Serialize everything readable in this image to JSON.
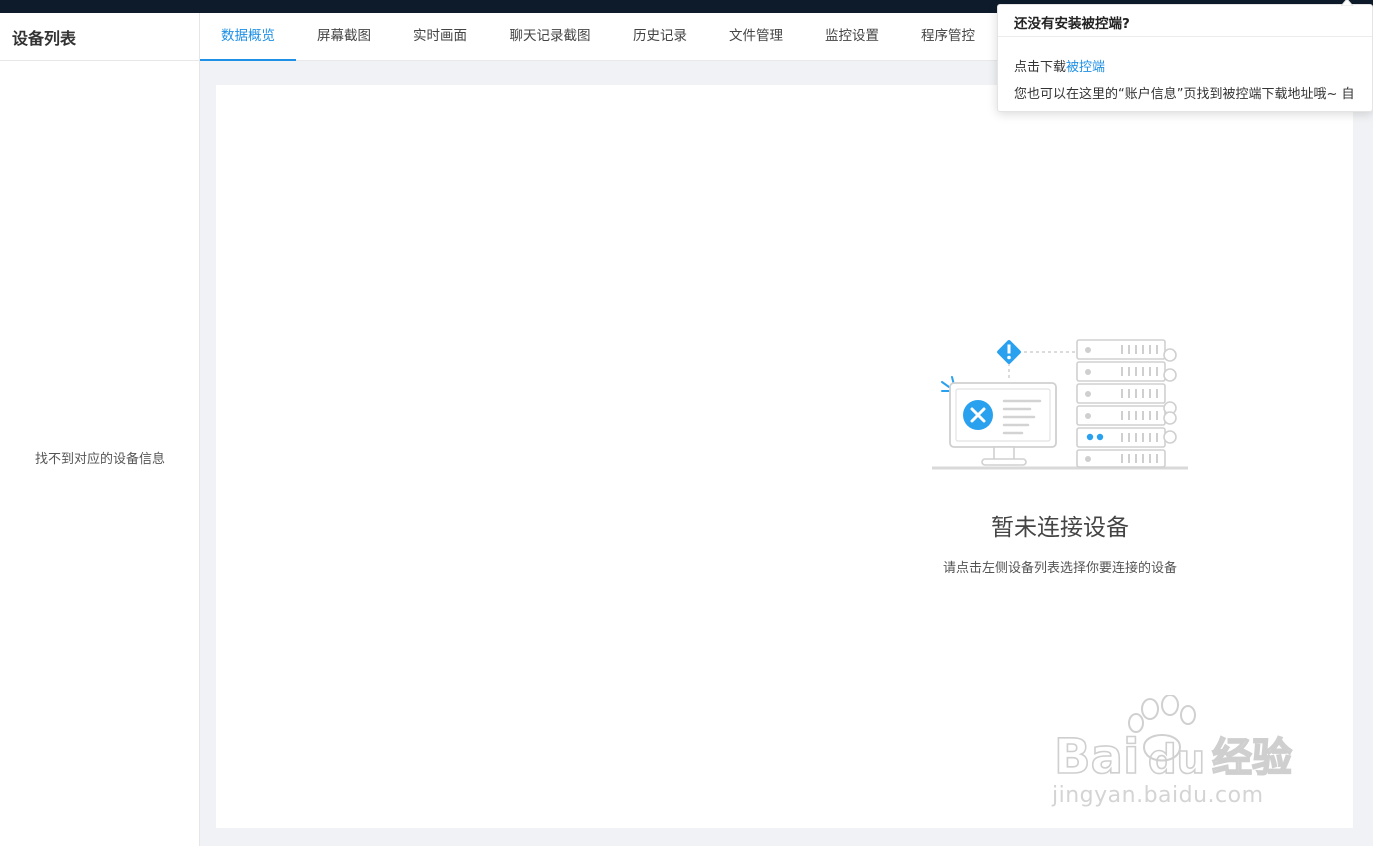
{
  "sidebar": {
    "title": "设备列表",
    "empty_text": "找不到对应的设备信息"
  },
  "tabs": [
    {
      "label": "数据概览",
      "active": true
    },
    {
      "label": "屏幕截图"
    },
    {
      "label": "实时画面"
    },
    {
      "label": "聊天记录截图"
    },
    {
      "label": "历史记录"
    },
    {
      "label": "文件管理"
    },
    {
      "label": "监控设置"
    },
    {
      "label": "程序管控"
    }
  ],
  "main": {
    "empty_title": "暂未连接设备",
    "empty_subtitle": "请点击左侧设备列表选择你要连接的设备"
  },
  "popover": {
    "title": "还没有安装被控端?",
    "line1_prefix": "点击下载",
    "line1_link": "被控端",
    "line2": "您也可以在这里的“账户信息”页找到被控端下载地址哦~   ",
    "line2_trailing": "自"
  },
  "watermark": {
    "brand": "Bai du 经验",
    "url": "jingyan.baidu.com"
  },
  "colors": {
    "accent": "#1e90e6",
    "topbar": "#0e1b2b",
    "background": "#f0f2f5"
  }
}
